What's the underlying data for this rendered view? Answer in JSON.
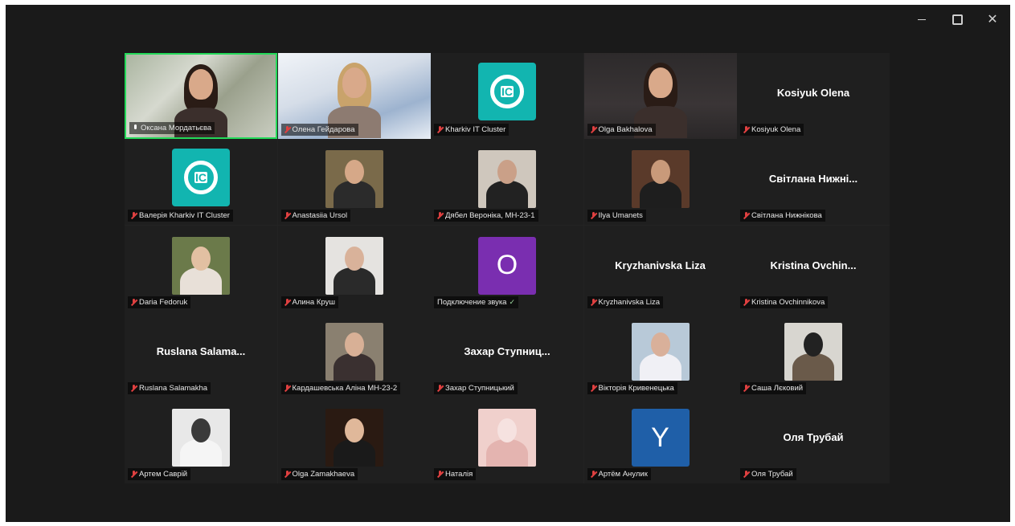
{
  "window": {
    "minimize": "",
    "restore": "",
    "close": "✕"
  },
  "participants": [
    {
      "name": "Оксана Мордатьєва",
      "type": "video",
      "variant": "a",
      "muted": false,
      "active": true
    },
    {
      "name": "Олена Гейдарова",
      "type": "video",
      "variant": "b",
      "muted": true
    },
    {
      "name": "Kharkiv IT Cluster",
      "type": "logo",
      "muted": true
    },
    {
      "name": "Olga Bakhalova",
      "type": "video",
      "variant": "c",
      "muted": true
    },
    {
      "name": "Kosiyuk Olena",
      "type": "text",
      "display": "Kosiyuk Olena",
      "muted": true
    },
    {
      "name": "Валерія Kharkiv IT Cluster",
      "type": "logo",
      "muted": true
    },
    {
      "name": "Anastasiia Ursol",
      "type": "photo",
      "bg": "#7a6a4a",
      "skin": "#d6a888",
      "cloth": "#2b2b2b",
      "muted": true
    },
    {
      "name": "Дябел Вероніка, МН-23-1",
      "type": "photo",
      "bg": "#cfc7bd",
      "skin": "#caa088",
      "cloth": "#222222",
      "muted": true
    },
    {
      "name": "Ilya Umanets",
      "type": "photo",
      "bg": "#5a3a2a",
      "skin": "#c99a7a",
      "cloth": "#1e1e1e",
      "muted": true
    },
    {
      "name": "Світлана Нижнікова",
      "type": "text",
      "display": "Світлана Нижні...",
      "muted": true
    },
    {
      "name": "Daria Fedoruk",
      "type": "photo",
      "bg": "#6b7a4a",
      "skin": "#e2c0a2",
      "cloth": "#e8e0d8",
      "muted": true
    },
    {
      "name": "Алина Круш",
      "type": "photo",
      "bg": "#e5e3e0",
      "skin": "#d9b29a",
      "cloth": "#2a2a2a",
      "muted": true
    },
    {
      "name": "Подключение звука",
      "type": "initial",
      "letter": "O",
      "color": "#7a2eb0",
      "muted": false,
      "connecting": true
    },
    {
      "name": "Kryzhanivska Liza",
      "type": "text",
      "display": "Kryzhanivska Liza",
      "muted": true
    },
    {
      "name": "Kristina Ovchinnikova",
      "type": "text",
      "display": "Kristina  Ovchin...",
      "muted": true
    },
    {
      "name": "Ruslana Salamakha",
      "type": "text",
      "display": "Ruslana  Salama...",
      "muted": true
    },
    {
      "name": "Кардашевська Аліна МН-23-2",
      "type": "photo",
      "bg": "#8a8070",
      "skin": "#d8b096",
      "cloth": "#3a3030",
      "muted": true
    },
    {
      "name": "Захар Ступницький",
      "type": "text",
      "display": "Захар  Ступниц...",
      "muted": true
    },
    {
      "name": "Вікторія Кривенецька",
      "type": "photo",
      "bg": "#b8c9d8",
      "skin": "#d9b09a",
      "cloth": "#f0f0f5",
      "muted": true
    },
    {
      "name": "Саша Лєковий",
      "type": "photo",
      "bg": "#d8d6d0",
      "skin": "#222222",
      "cloth": "#6a5a4a",
      "muted": true
    },
    {
      "name": "Артем Саврій",
      "type": "photo",
      "bg": "#e8e8e8",
      "skin": "#3a3a3a",
      "cloth": "#f5f5f5",
      "muted": true
    },
    {
      "name": "Olga Zamakhaeva",
      "type": "photo",
      "bg": "#2a1a12",
      "skin": "#e0b89a",
      "cloth": "#1a1a1a",
      "muted": true
    },
    {
      "name": "Наталія",
      "type": "photo",
      "bg": "#f0d0cc",
      "skin": "#f6e2e0",
      "cloth": "#e4b4b0",
      "muted": true
    },
    {
      "name": "Артём Анулик",
      "type": "initial",
      "letter": "Y",
      "color": "#1f5fa8",
      "muted": true
    },
    {
      "name": "Оля Трубай",
      "type": "text",
      "display": "Оля Трубай",
      "muted": true
    }
  ],
  "colors": {
    "active_border": "#23d959",
    "muted_mic": "#e04040",
    "logo_teal": "#12b5b0",
    "tile_bg": "#1f1f1f",
    "app_bg": "#1a1a1a"
  },
  "logo_text": "IC"
}
